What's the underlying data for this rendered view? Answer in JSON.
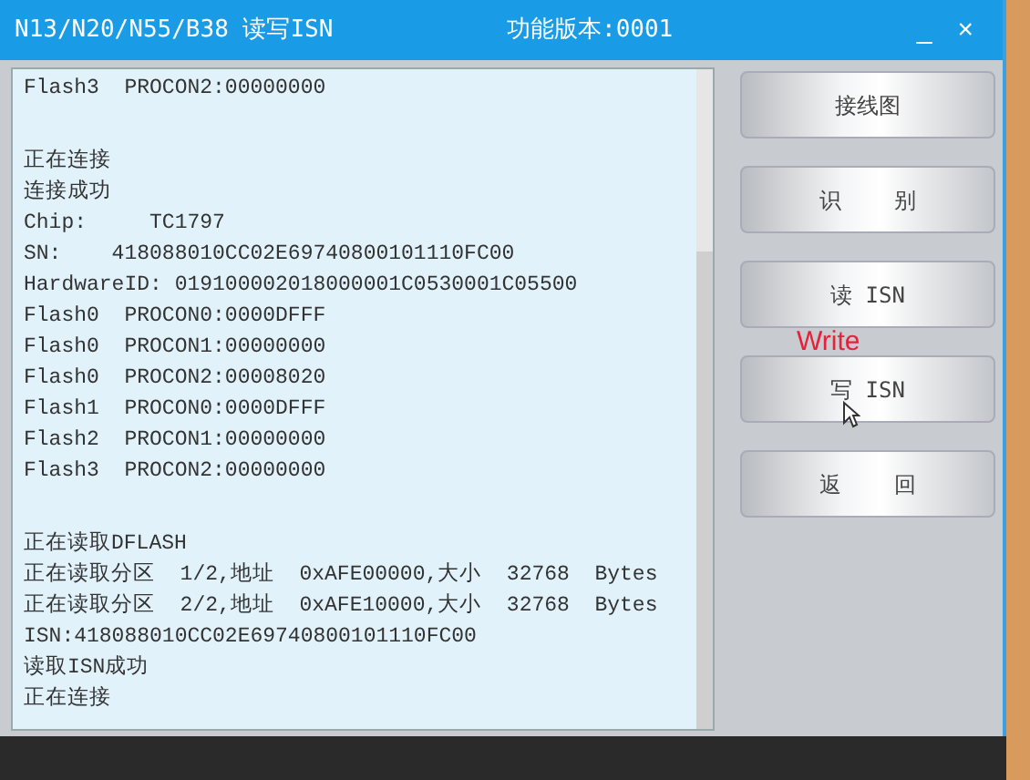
{
  "window": {
    "title": "N13/N20/N55/B38 读写ISN",
    "version": "功能版本:0001",
    "controls": [
      "_",
      "×"
    ]
  },
  "log": {
    "blocks": [
      [
        "Flash3  PROCON2:00000000"
      ],
      [
        "正在连接",
        "连接成功",
        "Chip:     TC1797",
        "SN:    418088010CC02E69740800101110FC00",
        "HardwareID: 019100002018000001C0530001C05500",
        "Flash0  PROCON0:0000DFFF",
        "Flash0  PROCON1:00000000",
        "Flash0  PROCON2:00008020",
        "Flash1  PROCON0:0000DFFF",
        "Flash2  PROCON1:00000000",
        "Flash3  PROCON2:00000000"
      ],
      [
        "正在读取DFLASH",
        "正在读取分区  1/2,地址  0xAFE00000,大小  32768  Bytes",
        "正在读取分区  2/2,地址  0xAFE10000,大小  32768  Bytes",
        "ISN:418088010CC02E69740800101110FC00",
        "读取ISN成功",
        "正在连接"
      ]
    ]
  },
  "buttons": [
    "接线图",
    "识    别",
    "读 ISN",
    "写 ISN",
    "返    回"
  ],
  "annotation": "Write"
}
